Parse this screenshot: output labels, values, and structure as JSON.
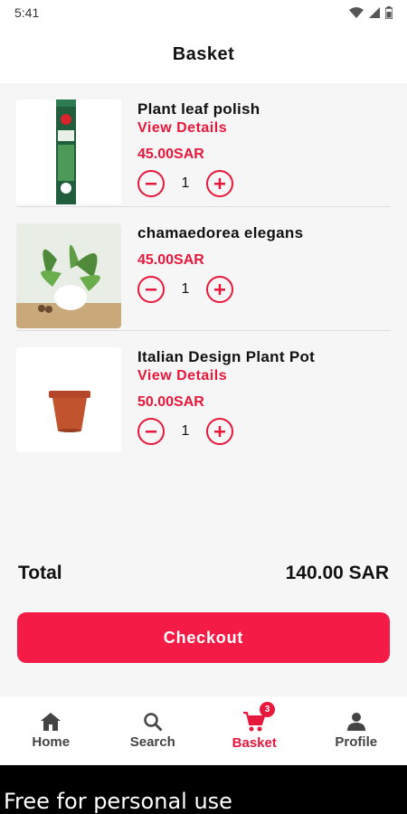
{
  "status": {
    "time": "5:41"
  },
  "header": {
    "title": "Basket"
  },
  "items": [
    {
      "name": "Plant leaf polish",
      "details": "View Details",
      "price": "45.00SAR",
      "qty": "1"
    },
    {
      "name": "chamaedorea elegans",
      "price": "45.00SAR",
      "qty": "1"
    },
    {
      "name": "Italian Design Plant Pot",
      "details": "View Details",
      "price": "50.00SAR",
      "qty": "1"
    }
  ],
  "summary": {
    "label": "Total",
    "value": "140.00 SAR"
  },
  "checkout": {
    "label": "Checkout"
  },
  "nav": {
    "home": "Home",
    "search": "Search",
    "basket": "Basket",
    "basket_badge": "3",
    "profile": "Profile"
  },
  "footer": {
    "text": "Free for personal use"
  },
  "colors": {
    "accent": "#e8173c",
    "button": "#f41c46"
  },
  "icons": [
    "wifi-icon",
    "signal-icon",
    "battery-icon",
    "minus-icon",
    "plus-icon",
    "home-icon",
    "search-icon",
    "cart-icon",
    "profile-icon"
  ]
}
